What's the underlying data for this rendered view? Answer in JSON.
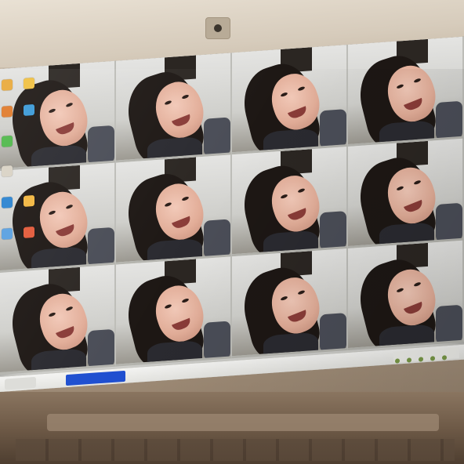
{
  "photo": {
    "subject": "",
    "icon_names": [
      "webcam-icon"
    ]
  },
  "desktop": {
    "icons": [
      {
        "label": "",
        "color": "#e8a93a"
      },
      {
        "label": "",
        "color": "#f0c040"
      },
      {
        "label": "",
        "color": "#e07a2a"
      },
      {
        "label": "",
        "color": "#3a9ad8"
      },
      {
        "label": "",
        "color": "#4fb84a"
      },
      {
        "label": "",
        "color": "#d9d2c4"
      },
      {
        "label": "",
        "color": "#2b83d0"
      },
      {
        "label": "",
        "color": "#f2b640"
      },
      {
        "label": "",
        "color": "#5aa0e0"
      },
      {
        "label": "",
        "color": "#e35a3a"
      }
    ]
  },
  "taskbar": {
    "active_window": "",
    "accent": "#1f4fd0"
  }
}
